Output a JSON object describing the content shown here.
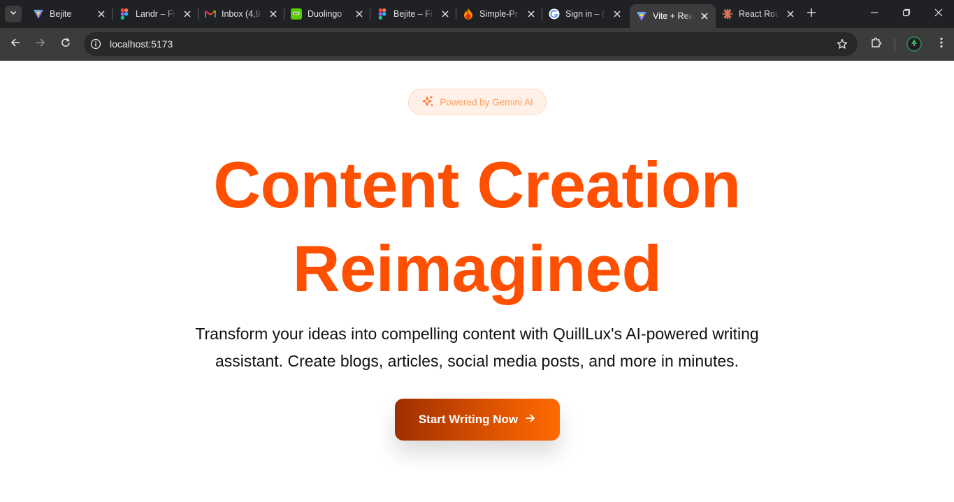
{
  "browser": {
    "tabs": [
      {
        "title": "Bejite",
        "favicon": "vite-icon",
        "active": false
      },
      {
        "title": "Landr – Fi",
        "favicon": "figma-icon",
        "active": false
      },
      {
        "title": "Inbox (4,9",
        "favicon": "gmail-icon",
        "active": false
      },
      {
        "title": "Duolingo",
        "favicon": "duolingo-icon",
        "active": false
      },
      {
        "title": "Bejite – Fi",
        "favicon": "figma-icon",
        "active": false
      },
      {
        "title": "Simple-Pr",
        "favicon": "firebase-icon",
        "active": false
      },
      {
        "title": "Sign in – (",
        "favicon": "google-icon",
        "active": false
      },
      {
        "title": "Vite + Rea",
        "favicon": "vite-icon",
        "active": true
      },
      {
        "title": "React Rou",
        "favicon": "claude-icon",
        "active": false
      }
    ],
    "address": "localhost:5173"
  },
  "page": {
    "badge": "Powered by Gemini AI",
    "headline_line1": "Content Creation",
    "headline_line2": "Reimagined",
    "subtitle": "Transform your ideas into compelling content with QuillLux's AI-powered writing assistant. Create blogs, articles, social media posts, and more in minutes.",
    "cta_label": "Start Writing Now"
  },
  "colors": {
    "accent": "#ff4f00",
    "badge_text": "#ff9a56",
    "cta_gradient_start": "#9e2f00",
    "cta_gradient_end": "#ff6b00"
  }
}
